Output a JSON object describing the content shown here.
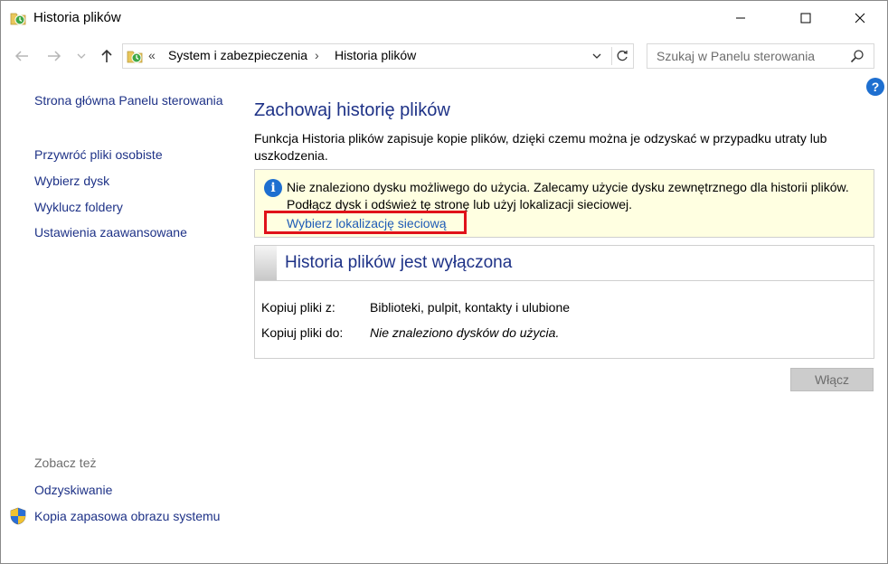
{
  "window": {
    "title": "Historia plików",
    "icon": "file-history-icon"
  },
  "nav": {
    "chevrons": "«",
    "breadcrumb": [
      "System i zabezpieczenia",
      "Historia plików"
    ],
    "separator": "›",
    "search_placeholder": "Szukaj w Panelu sterowania"
  },
  "help": {
    "label": "?"
  },
  "sidebar": {
    "links": [
      "Strona główna Panelu sterowania",
      "Przywróć pliki osobiste",
      "Wybierz dysk",
      "Wyklucz foldery",
      "Ustawienia zaawansowane"
    ],
    "see_also_heading": "Zobacz też",
    "see_also": [
      "Odzyskiwanie",
      "Kopia zapasowa obrazu systemu"
    ]
  },
  "main": {
    "title": "Zachowaj historię plików",
    "description": "Funkcja Historia plików zapisuje kopie plików, dzięki czemu można je odzyskać w przypadku utraty lub uszkodzenia.",
    "info": {
      "icon_label": "i",
      "text": "Nie znaleziono dysku możliwego do użycia. Zalecamy użycie dysku zewnętrznego dla historii plików. Podłącz dysk i odśwież tę stronę lub użyj lokalizacji sieciowej.",
      "link": "Wybierz lokalizację sieciową",
      "highlight_color": "#e0121a"
    },
    "status": {
      "title": "Historia plików jest wyłączona",
      "copy_from_label": "Kopiuj pliki z:",
      "copy_from_value": "Biblioteki, pulpit, kontakty i ulubione",
      "copy_to_label": "Kopiuj pliki do:",
      "copy_to_value": "Nie znaleziono dysków do użycia."
    },
    "enable_button": "Włącz"
  }
}
